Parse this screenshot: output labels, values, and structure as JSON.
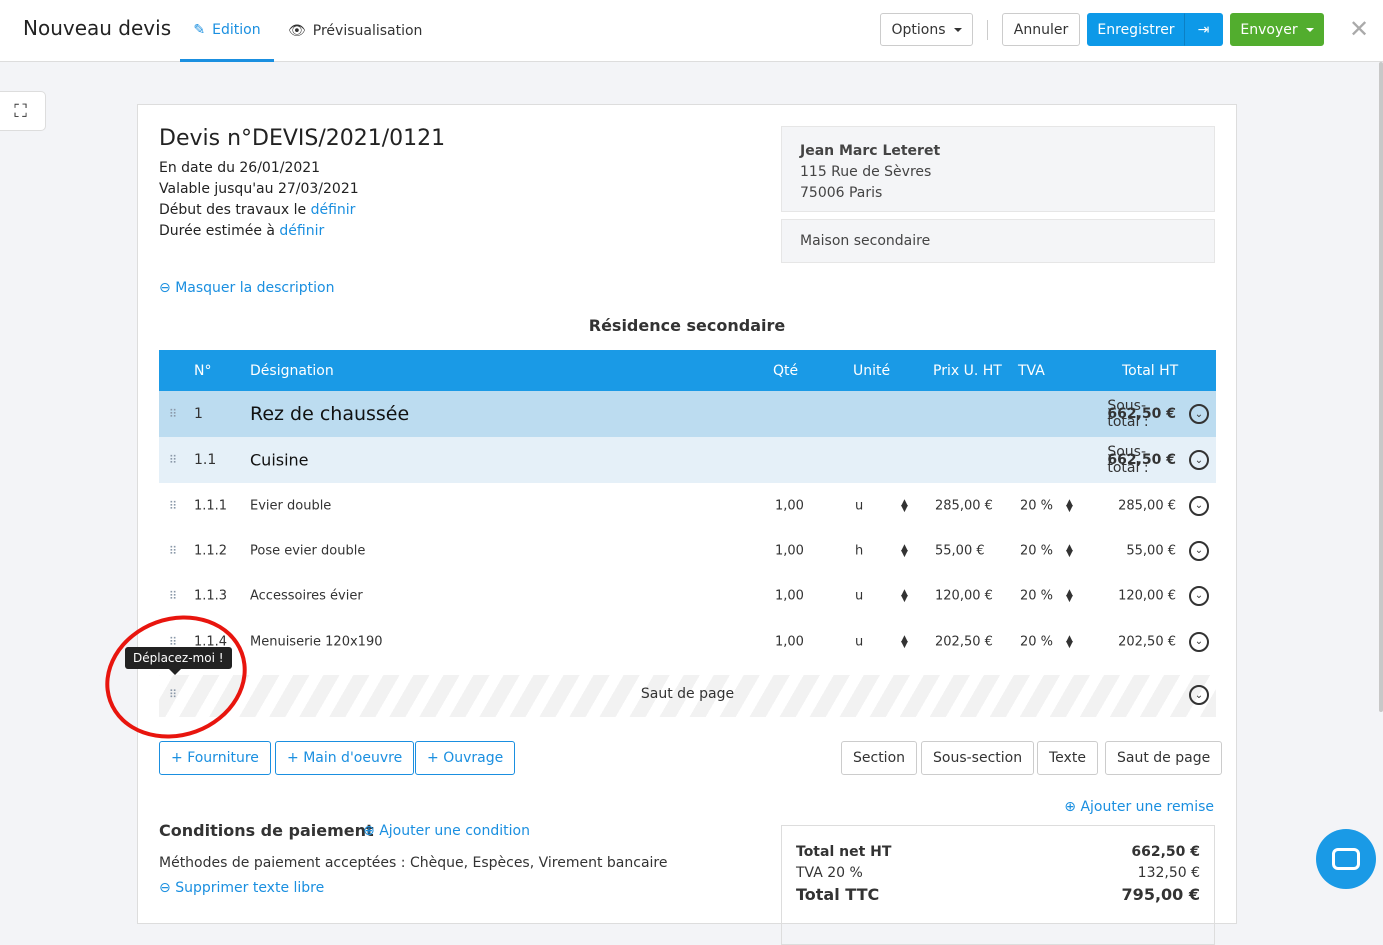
{
  "header": {
    "title": "Nouveau devis",
    "tabs": [
      {
        "label": "Edition",
        "icon": "pencil-icon"
      },
      {
        "label": "Prévisualisation",
        "icon": "eye-icon"
      }
    ],
    "options": "Options",
    "cancel": "Annuler",
    "save": "Enregistrer",
    "send": "Envoyer"
  },
  "colors": {
    "accent": "#1a9ae6",
    "send": "#52ad2e",
    "annotation": "#e8150e"
  },
  "quote": {
    "title": "Devis n°DEVIS/2021/0121",
    "date": "En date du 26/01/2021",
    "valid": "Valable jusqu'au 27/03/2021",
    "start_label": "Début des travaux le ",
    "start_link": "définir",
    "duration_label": "Durée estimée à ",
    "duration_link": "définir",
    "hide_desc": "Masquer la description",
    "section_title": "Résidence secondaire"
  },
  "client": {
    "name": "Jean Marc Leteret",
    "street": "115 Rue de Sèvres",
    "city": "75006 Paris",
    "site": "Maison secondaire"
  },
  "table": {
    "headers": [
      "N°",
      "Désignation",
      "Qté",
      "Unité",
      "Prix U. HT",
      "TVA",
      "Total HT"
    ],
    "section": {
      "num": "1",
      "name": "Rez de chaussée",
      "subtotal_label": "Sous-total : ",
      "subtotal": "662,50 €"
    },
    "subsection": {
      "num": "1.1",
      "name": "Cuisine",
      "subtotal_label": "Sous-total : ",
      "subtotal": "662,50 €"
    },
    "rows": [
      {
        "num": "1.1.1",
        "name": "Evier double",
        "qty": "1,00",
        "unit": "u",
        "price": "285,00 €",
        "tva": "20 %",
        "total": "285,00 €"
      },
      {
        "num": "1.1.2",
        "name": "Pose evier double",
        "qty": "1,00",
        "unit": "h",
        "price": "55,00 €",
        "tva": "20 %",
        "total": "55,00 €"
      },
      {
        "num": "1.1.3",
        "name": "Accessoires évier",
        "qty": "1,00",
        "unit": "u",
        "price": "120,00 €",
        "tva": "20 %",
        "total": "120,00 €"
      },
      {
        "num": "1.1.4",
        "name": "Menuiserie 120x190",
        "qty": "1,00",
        "unit": "u",
        "price": "202,50 €",
        "tva": "20 %",
        "total": "202,50 €"
      }
    ],
    "page_break": "Saut de page"
  },
  "tooltip": "Déplacez-moi !",
  "add_buttons": [
    "Fourniture",
    "Main d'oeuvre",
    "Ouvrage"
  ],
  "struct_buttons": [
    "Section",
    "Sous-section",
    "Texte",
    "Saut de page"
  ],
  "discount": "Ajouter une remise",
  "payment": {
    "title": "Conditions de paiement",
    "add": "Ajouter une condition",
    "methods": "Méthodes de paiement acceptées : Chèque, Espèces, Virement bancaire",
    "remove": "Supprimer texte libre"
  },
  "totals": {
    "net_label": "Total net HT",
    "net": "662,50 €",
    "tva_label": "TVA 20 %",
    "tva": "132,50 €",
    "ttc_label": "Total TTC",
    "ttc": "795,00 €"
  }
}
